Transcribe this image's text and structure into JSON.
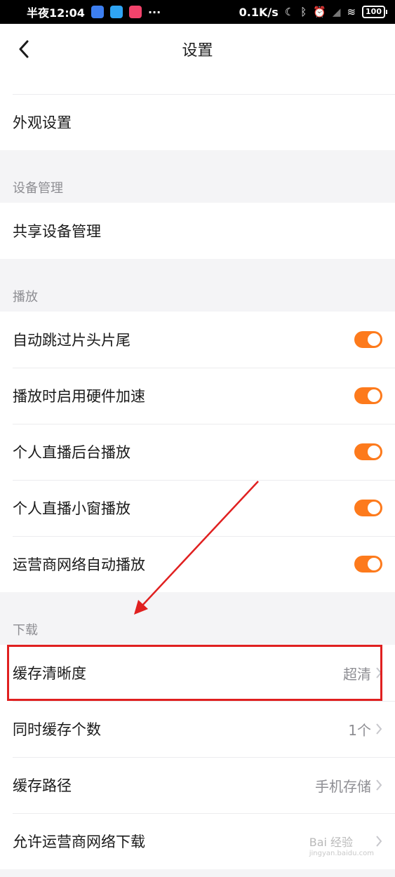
{
  "status_bar": {
    "time": "半夜12:04",
    "more": "···",
    "network_speed": "0.1K/s",
    "battery": "100"
  },
  "header": {
    "title": "设置"
  },
  "rows": {
    "appearance": "外观设置"
  },
  "sections": {
    "device": {
      "header": "设备管理",
      "items": [
        "共享设备管理"
      ]
    },
    "playback": {
      "header": "播放",
      "items": [
        {
          "label": "自动跳过片头片尾",
          "on": true
        },
        {
          "label": "播放时启用硬件加速",
          "on": true
        },
        {
          "label": "个人直播后台播放",
          "on": true
        },
        {
          "label": "个人直播小窗播放",
          "on": true
        },
        {
          "label": "运营商网络自动播放",
          "on": true
        }
      ]
    },
    "download": {
      "header": "下载",
      "items": [
        {
          "label": "缓存清晰度",
          "value": "超清"
        },
        {
          "label": "同时缓存个数",
          "value": "1个"
        },
        {
          "label": "缓存路径",
          "value": "手机存储"
        },
        {
          "label": "允许运营商网络下载",
          "value": ""
        }
      ]
    }
  },
  "watermark": {
    "text": "Bai 经验",
    "sub": "jingyan.baidu.com"
  },
  "colors": {
    "toggle_on": "#fd7a1c",
    "highlight": "#e02020",
    "secondary_text": "#8e8e93"
  }
}
